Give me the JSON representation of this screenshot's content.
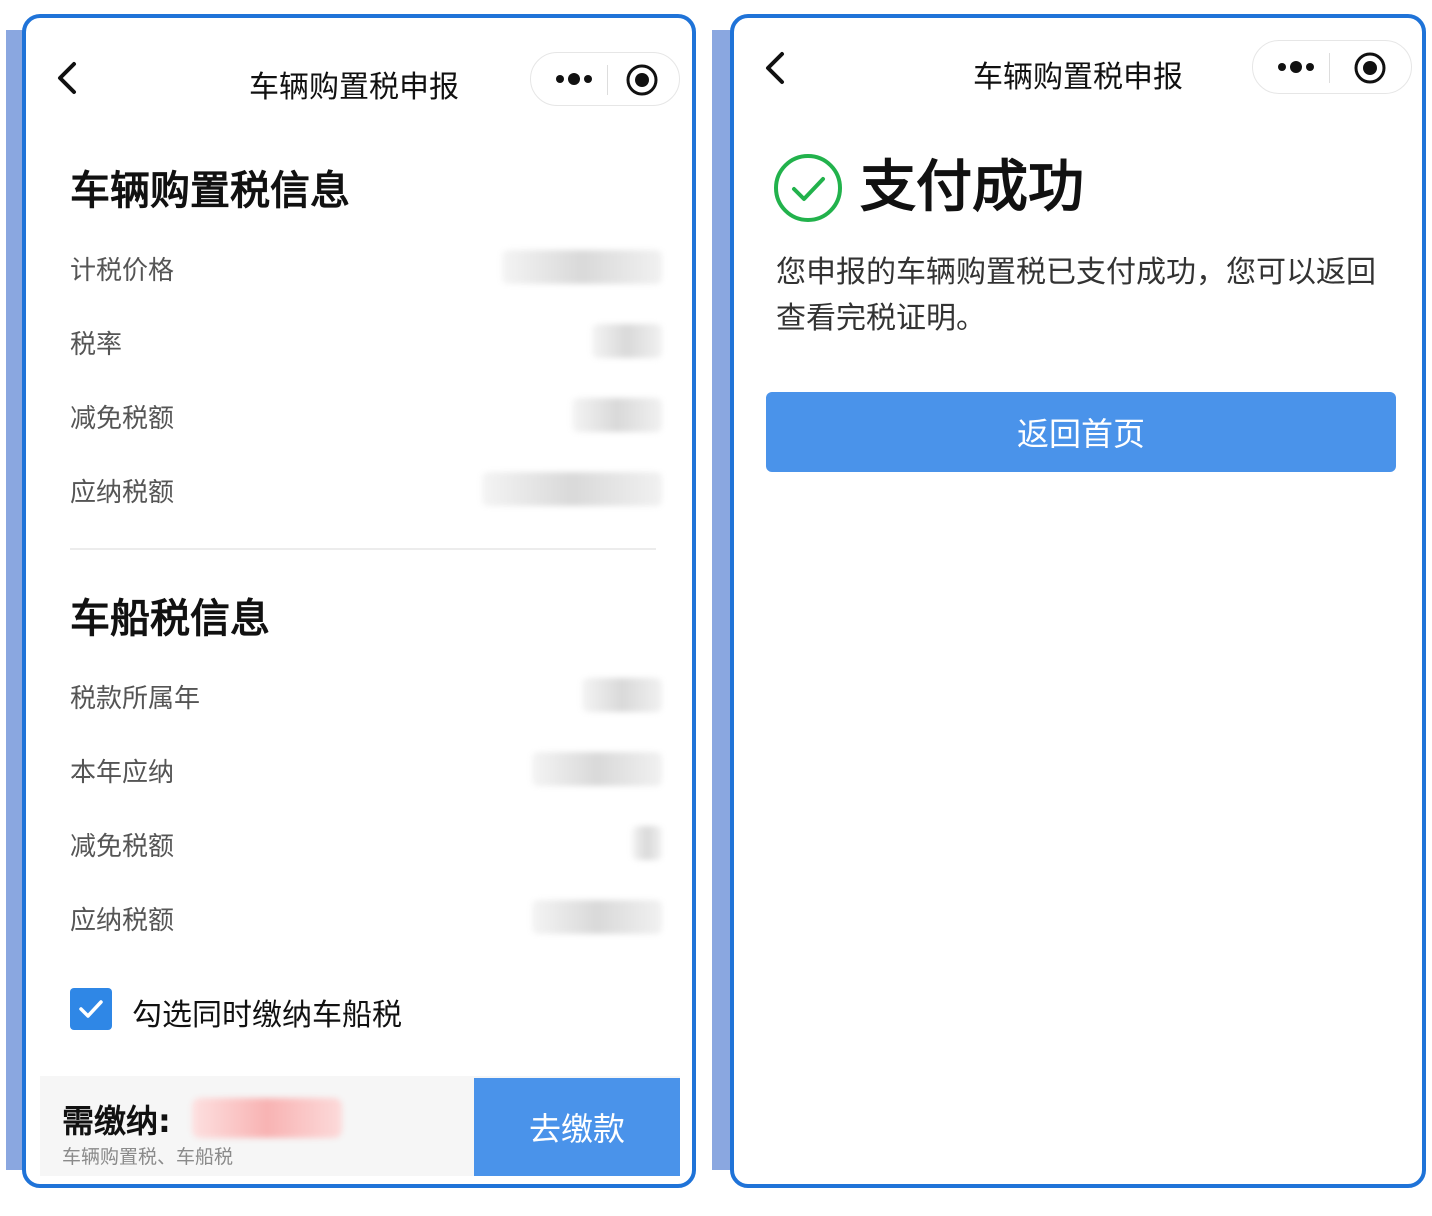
{
  "left_screen": {
    "nav": {
      "title": "车辆购置税申报"
    },
    "purchase_tax": {
      "title": "车辆购置税信息",
      "rows": [
        {
          "label": "计税价格"
        },
        {
          "label": "税率"
        },
        {
          "label": "减免税额"
        },
        {
          "label": "应纳税额"
        }
      ]
    },
    "vessel_tax": {
      "title": "车船税信息",
      "rows": [
        {
          "label": "税款所属年"
        },
        {
          "label": "本年应纳"
        },
        {
          "label": "减免税额"
        },
        {
          "label": "应纳税额"
        }
      ]
    },
    "checkbox": {
      "label": "勾选同时缴纳车船税",
      "checked": true
    },
    "footer": {
      "pay_label": "需缴纳:",
      "pay_sub": "车辆购置税、车船税",
      "pay_button": "去缴款"
    }
  },
  "right_screen": {
    "nav": {
      "title": "车辆购置税申报"
    },
    "success_title": "支付成功",
    "success_desc": "您申报的车辆购置税已支付成功，您可以返回查看完税证明。",
    "home_button": "返回首页"
  },
  "colors": {
    "frame_border": "#1f73d8",
    "accent_strip": "#8aa7e0",
    "primary_button": "#4a93ea",
    "checkbox": "#2f87e6",
    "success_green": "#22b24c"
  },
  "icons": [
    "back-icon",
    "more-dots-icon",
    "target-icon",
    "checkmark-icon",
    "success-check-icon"
  ]
}
